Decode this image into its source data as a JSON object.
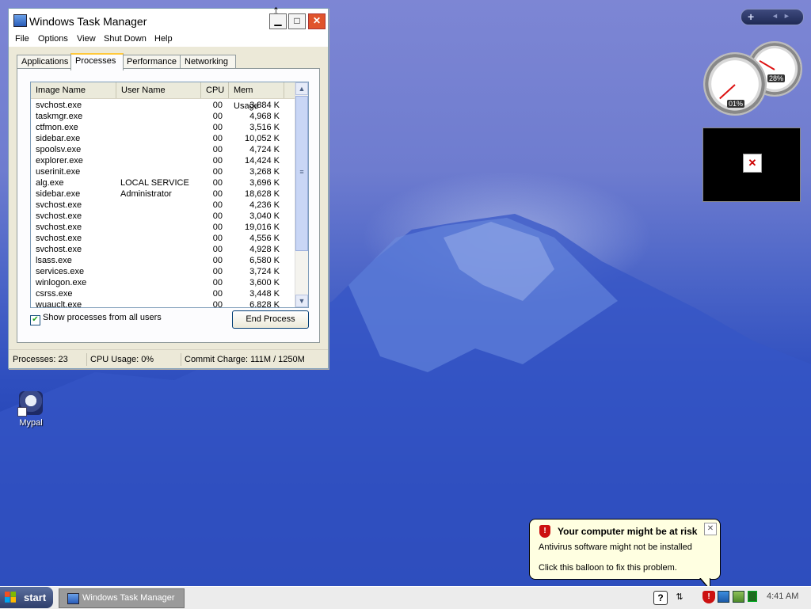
{
  "window": {
    "title": "Windows Task Manager",
    "menu": [
      "File",
      "Options",
      "View",
      "Shut Down",
      "Help"
    ],
    "tabs": [
      "Applications",
      "Processes",
      "Performance",
      "Networking"
    ],
    "active_tab": "Processes",
    "columns": [
      "Image Name",
      "User Name",
      "CPU",
      "Mem Usage"
    ],
    "processes": [
      {
        "name": "svchost.exe",
        "user": "",
        "cpu": "00",
        "mem": "3,884 K"
      },
      {
        "name": "taskmgr.exe",
        "user": "",
        "cpu": "00",
        "mem": "4,968 K"
      },
      {
        "name": "ctfmon.exe",
        "user": "",
        "cpu": "00",
        "mem": "3,516 K"
      },
      {
        "name": "sidebar.exe",
        "user": "",
        "cpu": "00",
        "mem": "10,052 K"
      },
      {
        "name": "spoolsv.exe",
        "user": "",
        "cpu": "00",
        "mem": "4,724 K"
      },
      {
        "name": "explorer.exe",
        "user": "",
        "cpu": "00",
        "mem": "14,424 K"
      },
      {
        "name": "userinit.exe",
        "user": "",
        "cpu": "00",
        "mem": "3,268 K"
      },
      {
        "name": "alg.exe",
        "user": "LOCAL SERVICE",
        "cpu": "00",
        "mem": "3,696 K"
      },
      {
        "name": "sidebar.exe",
        "user": "Administrator",
        "cpu": "00",
        "mem": "18,628 K"
      },
      {
        "name": "svchost.exe",
        "user": "",
        "cpu": "00",
        "mem": "4,236 K"
      },
      {
        "name": "svchost.exe",
        "user": "",
        "cpu": "00",
        "mem": "3,040 K"
      },
      {
        "name": "svchost.exe",
        "user": "",
        "cpu": "00",
        "mem": "19,016 K"
      },
      {
        "name": "svchost.exe",
        "user": "",
        "cpu": "00",
        "mem": "4,556 K"
      },
      {
        "name": "svchost.exe",
        "user": "",
        "cpu": "00",
        "mem": "4,928 K"
      },
      {
        "name": "lsass.exe",
        "user": "",
        "cpu": "00",
        "mem": "6,580 K"
      },
      {
        "name": "services.exe",
        "user": "",
        "cpu": "00",
        "mem": "3,724 K"
      },
      {
        "name": "winlogon.exe",
        "user": "",
        "cpu": "00",
        "mem": "3,600 K"
      },
      {
        "name": "csrss.exe",
        "user": "",
        "cpu": "00",
        "mem": "3,448 K"
      },
      {
        "name": "wuauclt.exe",
        "user": "",
        "cpu": "00",
        "mem": "6,828 K"
      }
    ],
    "show_all_label": "Show processes from all users",
    "show_all_checked": true,
    "end_process_label": "End Process",
    "status": {
      "processes": "Processes: 23",
      "cpu": "CPU Usage: 0%",
      "commit": "Commit Charge: 111M / 1250M"
    }
  },
  "desktop": {
    "icon_label": "Mypal"
  },
  "gadgets": {
    "cpu_gauge_label": "01%",
    "mem_gauge_label": "28%",
    "cpu_fraction": 0.01,
    "mem_fraction": 0.28
  },
  "balloon": {
    "title": "Your computer might be at risk",
    "line1": "Antivirus software might not be installed",
    "line2": "Click this balloon to fix this problem."
  },
  "taskbar": {
    "start_label": "start",
    "task_button_label": "Windows Task Manager",
    "clock": "4:41 AM"
  },
  "colors": {
    "balloon_bg": "#ffffe1",
    "close_red": "#e0542c",
    "shield_red": "#cc1111"
  }
}
